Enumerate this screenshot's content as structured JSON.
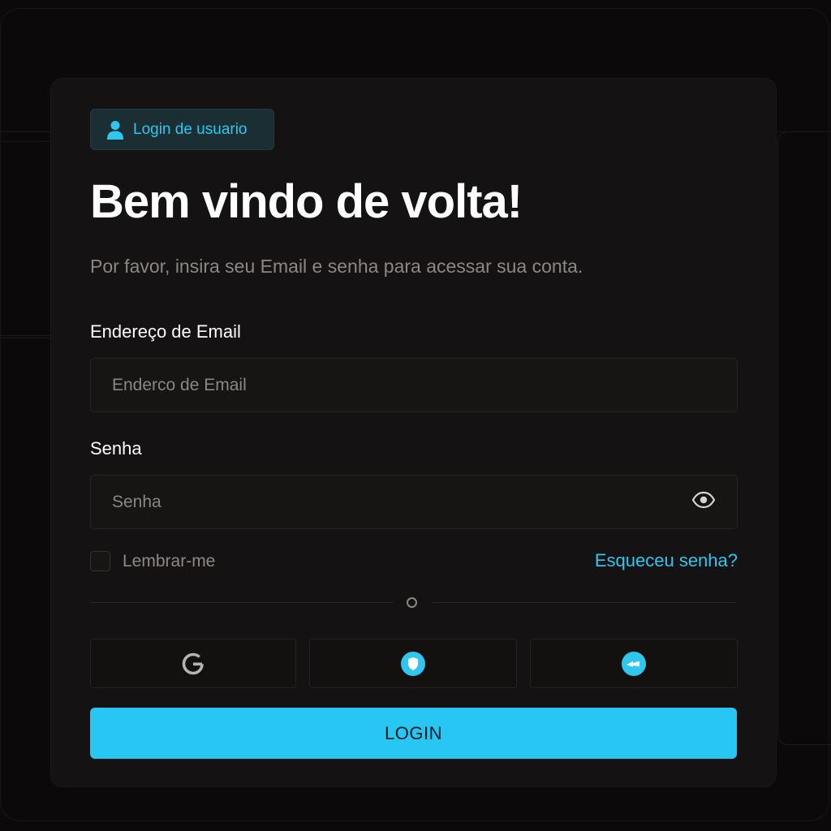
{
  "badge": {
    "label": "Login de usuario",
    "icon": "user-icon"
  },
  "heading": {
    "title": "Bem vindo de volta!",
    "subtitle": "Por favor, insira seu Email e senha para acessar sua conta."
  },
  "email": {
    "label": "Endereço de Email",
    "placeholder": "Enderco de Email",
    "value": ""
  },
  "password": {
    "label": "Senha",
    "placeholder": "Senha",
    "value": "",
    "toggle_icon": "eye-icon"
  },
  "remember_me": {
    "label": "Lembrar-me",
    "checked": false
  },
  "forgot_password": {
    "label": "Esqueceu senha?"
  },
  "social_buttons": [
    {
      "icon": "google-icon"
    },
    {
      "icon": "shield-icon"
    },
    {
      "icon": "arrow-icon"
    }
  ],
  "login_button": {
    "label": "LOGIN"
  },
  "colors": {
    "accent": "#27c6f3",
    "background": "#0b0909",
    "card": "#141212",
    "text_primary": "#ffffff",
    "text_muted": "#8b8784"
  }
}
